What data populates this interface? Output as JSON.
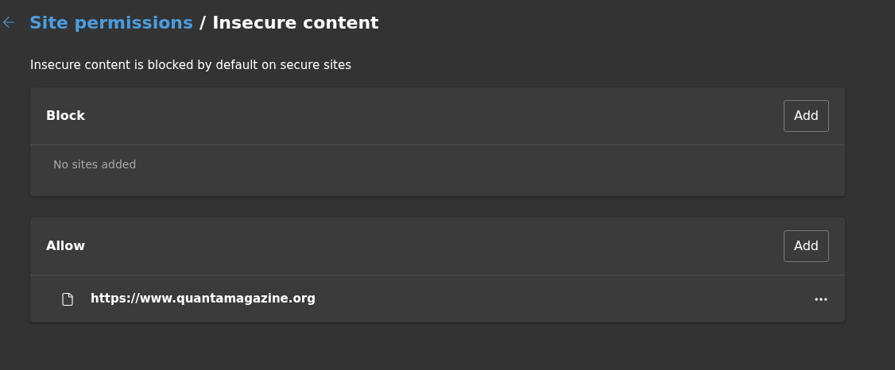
{
  "header": {
    "parent": "Site permissions",
    "separator": "/",
    "title": "Insecure content"
  },
  "description": "Insecure content is blocked by default on secure sites",
  "sections": [
    {
      "title": "Block",
      "button": "Add",
      "empty_text": "No sites added"
    },
    {
      "title": "Allow",
      "button": "Add",
      "sites": [
        {
          "url": "https://www.quantamagazine.org"
        }
      ]
    }
  ]
}
